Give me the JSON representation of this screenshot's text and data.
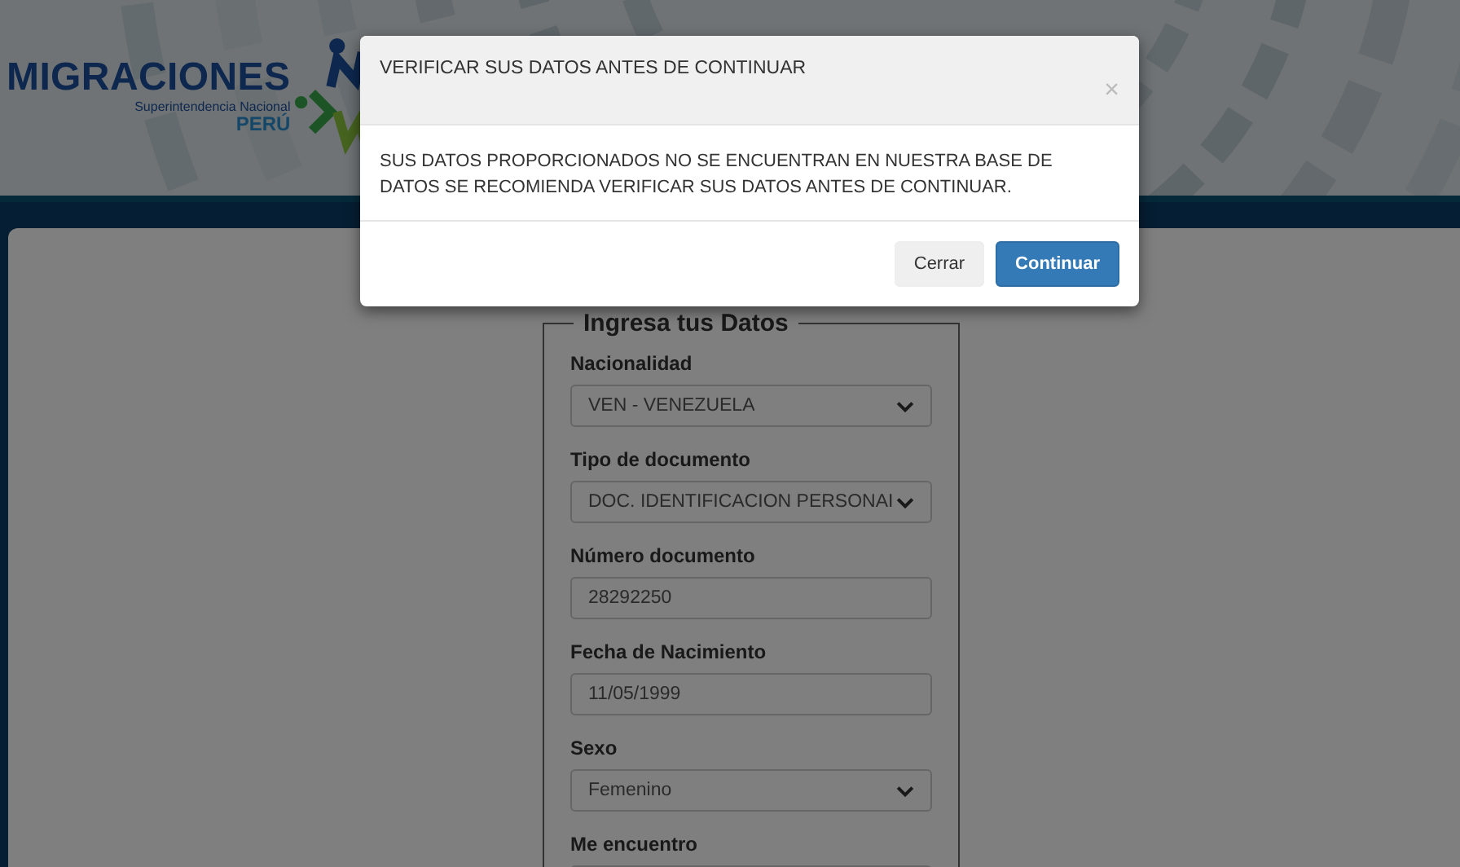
{
  "header": {
    "logo_text": "MIGRACIONES",
    "logo_subtitle": "Superintendencia Nacional",
    "logo_country": "PERÚ"
  },
  "form": {
    "legend": "Ingresa tus Datos",
    "fields": [
      {
        "kind": "select",
        "label": "Nacionalidad",
        "value": "VEN - VENEZUELA"
      },
      {
        "kind": "select",
        "label": "Tipo de documento",
        "value": "DOC. IDENTIFICACION PERSONAI"
      },
      {
        "kind": "input",
        "label": "Número documento",
        "value": "28292250"
      },
      {
        "kind": "input",
        "label": "Fecha de Nacimiento",
        "value": "11/05/1999"
      },
      {
        "kind": "select",
        "label": "Sexo",
        "value": "Femenino"
      },
      {
        "kind": "select",
        "label": "Me encuentro"
      }
    ]
  },
  "modal": {
    "title": "VERIFICAR SUS DATOS ANTES DE CONTINUAR",
    "close": "×",
    "message": "SUS DATOS PROPORCIONADOS NO SE ENCUENTRAN EN NUESTRA BASE DE DATOS SE RECOMIENDA VERIFICAR SUS DATOS ANTES DE CONTINUAR.",
    "buttons": [
      {
        "kind": "secondary",
        "label": "Cerrar"
      },
      {
        "kind": "primary",
        "label": "Continuar"
      }
    ]
  }
}
